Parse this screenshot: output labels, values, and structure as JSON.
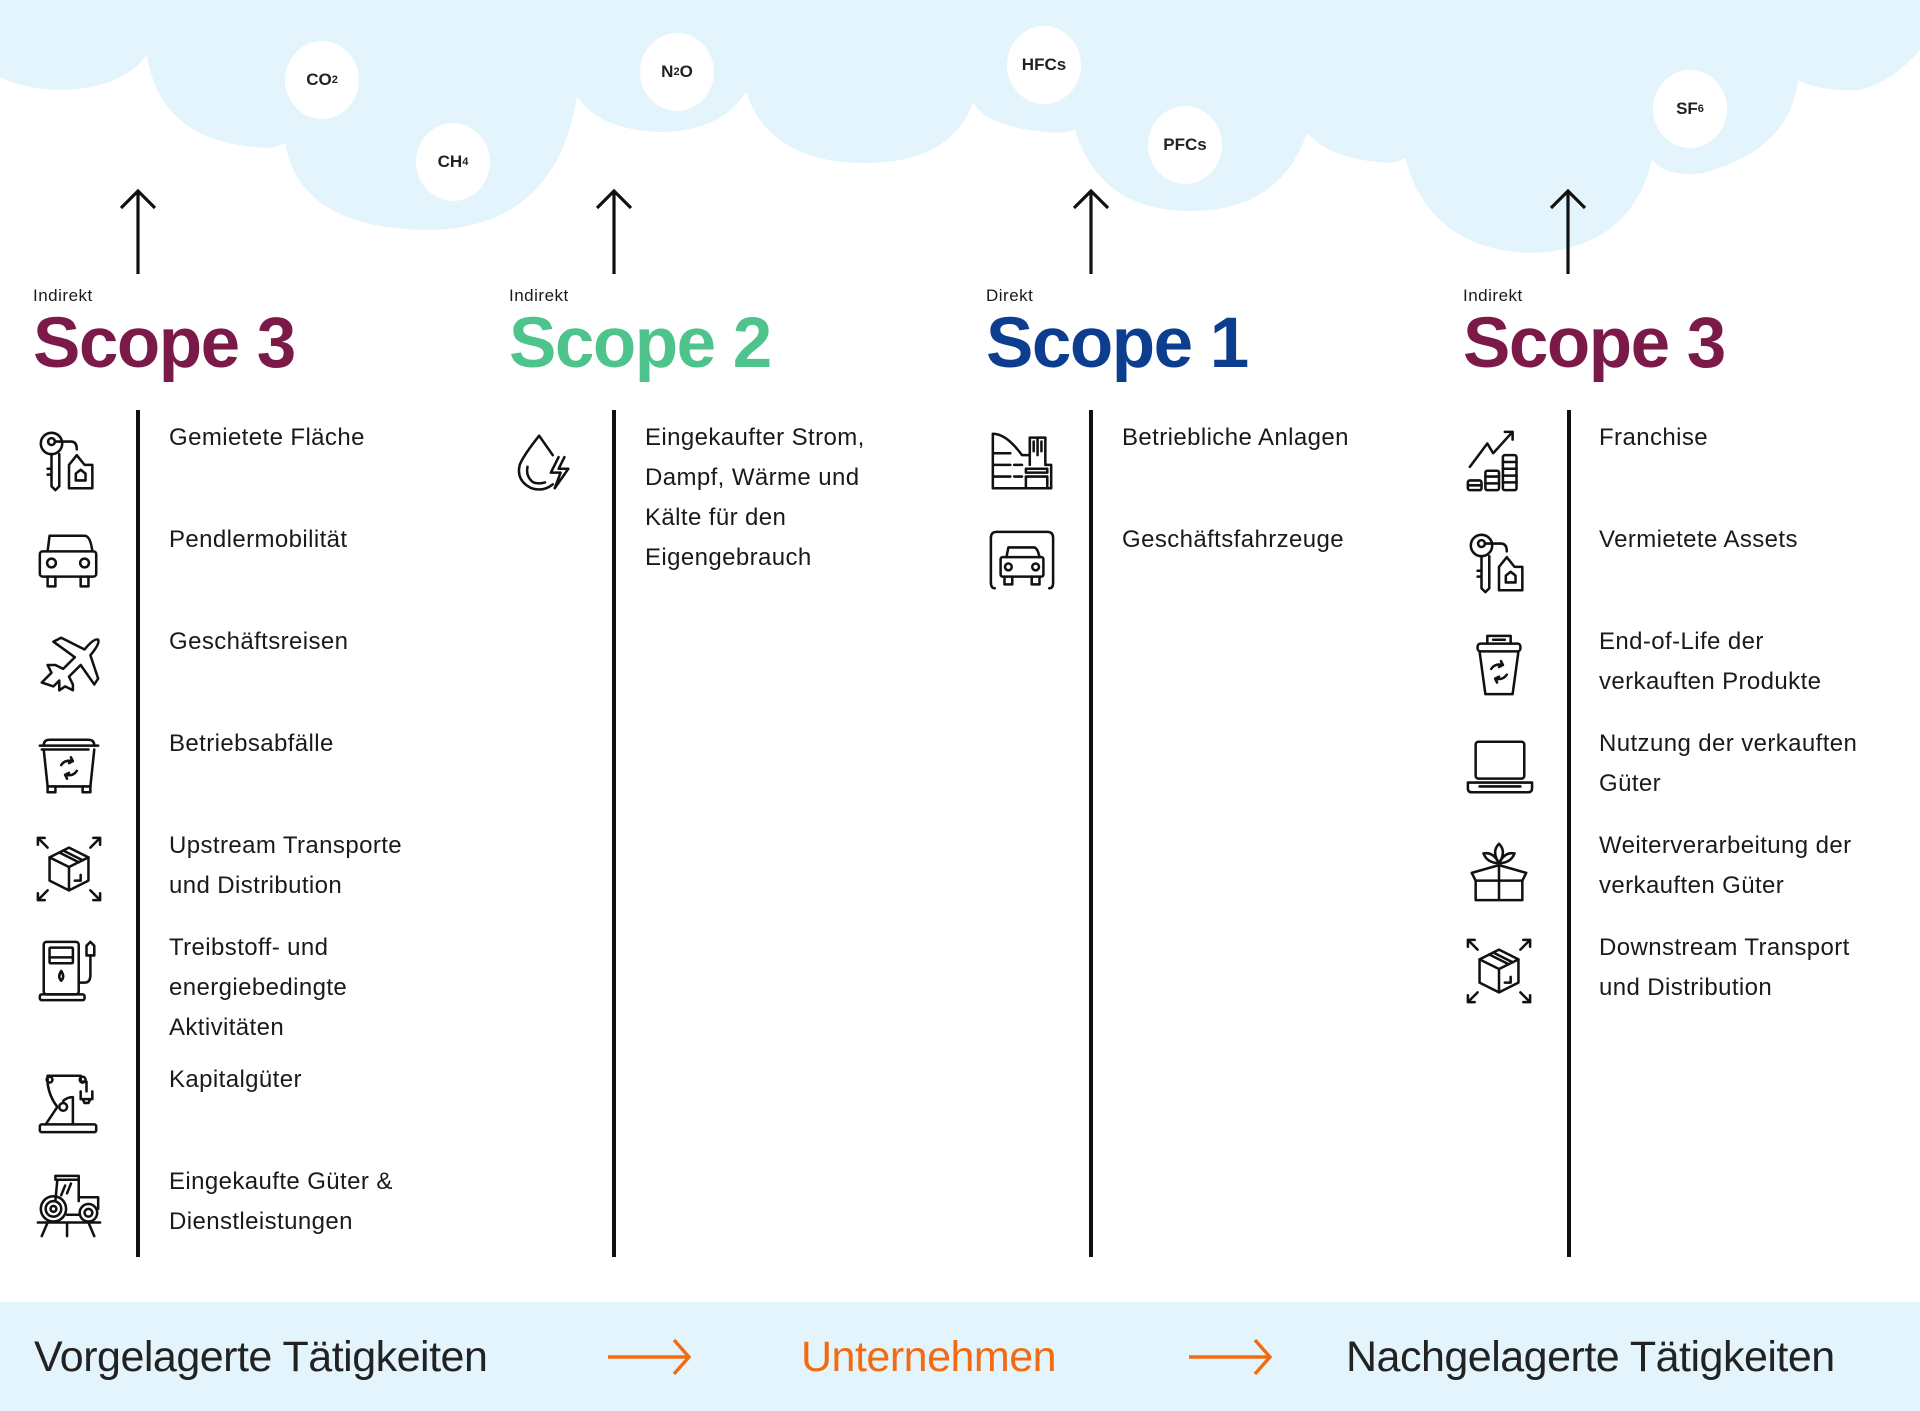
{
  "colors": {
    "scope3": "#7b1a48",
    "scope2": "#4ec48c",
    "scope1": "#0d3d8f",
    "accent_orange": "#f26b12",
    "cloud": "#e3f4fc",
    "text": "#1a1a1a"
  },
  "gases": [
    {
      "name": "CO",
      "sub": "2"
    },
    {
      "name": "CH",
      "sub": "4"
    },
    {
      "name": "N",
      "sub": "2",
      "suffix": "O"
    },
    {
      "name": "HFCs",
      "sub": ""
    },
    {
      "name": "PFCs",
      "sub": ""
    },
    {
      "name": "SF",
      "sub": "6"
    }
  ],
  "columns": [
    {
      "kind": "Indirekt",
      "title": "Scope 3",
      "color_key": "scope3",
      "items": [
        {
          "icon": "key-house-tag-icon",
          "text": "Gemietete Fläche"
        },
        {
          "icon": "car-icon",
          "text": "Pendlermobilität"
        },
        {
          "icon": "airplane-icon",
          "text": "Geschäftsreisen"
        },
        {
          "icon": "recycling-container-icon",
          "text": "Betriebsabfälle"
        },
        {
          "icon": "box-distribution-icon",
          "text": "Upstream Transporte\nund Distribution"
        },
        {
          "icon": "fuel-pump-icon",
          "text": "Treibstoff- und\nenergiebedingte\nAktivitäten"
        },
        {
          "icon": "robot-arm-icon",
          "text": "Kapitalgüter"
        },
        {
          "icon": "tractor-icon",
          "text": "Eingekaufte Güter &\nDienstleistungen"
        }
      ]
    },
    {
      "kind": "Indirekt",
      "title": "Scope 2",
      "color_key": "scope2",
      "items": [
        {
          "icon": "drop-lightning-icon",
          "text": "Eingekaufter Strom,\nDampf, Wärme und\nKälte für den\nEigengebrauch"
        }
      ]
    },
    {
      "kind": "Direkt",
      "title": "Scope 1",
      "color_key": "scope1",
      "items": [
        {
          "icon": "factory-icon",
          "text": "Betriebliche Anlagen"
        },
        {
          "icon": "garage-car-icon",
          "text": "Geschäftsfahrzeuge"
        }
      ]
    },
    {
      "kind": "Indirekt",
      "title": "Scope 3",
      "color_key": "scope3",
      "items": [
        {
          "icon": "growth-coins-icon",
          "text": "Franchise"
        },
        {
          "icon": "key-house-tag-icon",
          "text": "Vermietete Assets"
        },
        {
          "icon": "recycling-bin-icon",
          "text": "End-of-Life der\nverkauften Produkte"
        },
        {
          "icon": "laptop-icon",
          "text": "Nutzung der verkauften\nGüter"
        },
        {
          "icon": "plant-box-icon",
          "text": "Weiterverarbeitung der\nverkauften Güter"
        },
        {
          "icon": "box-distribution-icon",
          "text": "Downstream Transport\nund Distribution"
        }
      ]
    }
  ],
  "flow": {
    "upstream": "Vorgelagerte Tätigkeiten",
    "company": "Unternehmen",
    "downstream": "Nachgelagerte Tätigkeiten"
  }
}
